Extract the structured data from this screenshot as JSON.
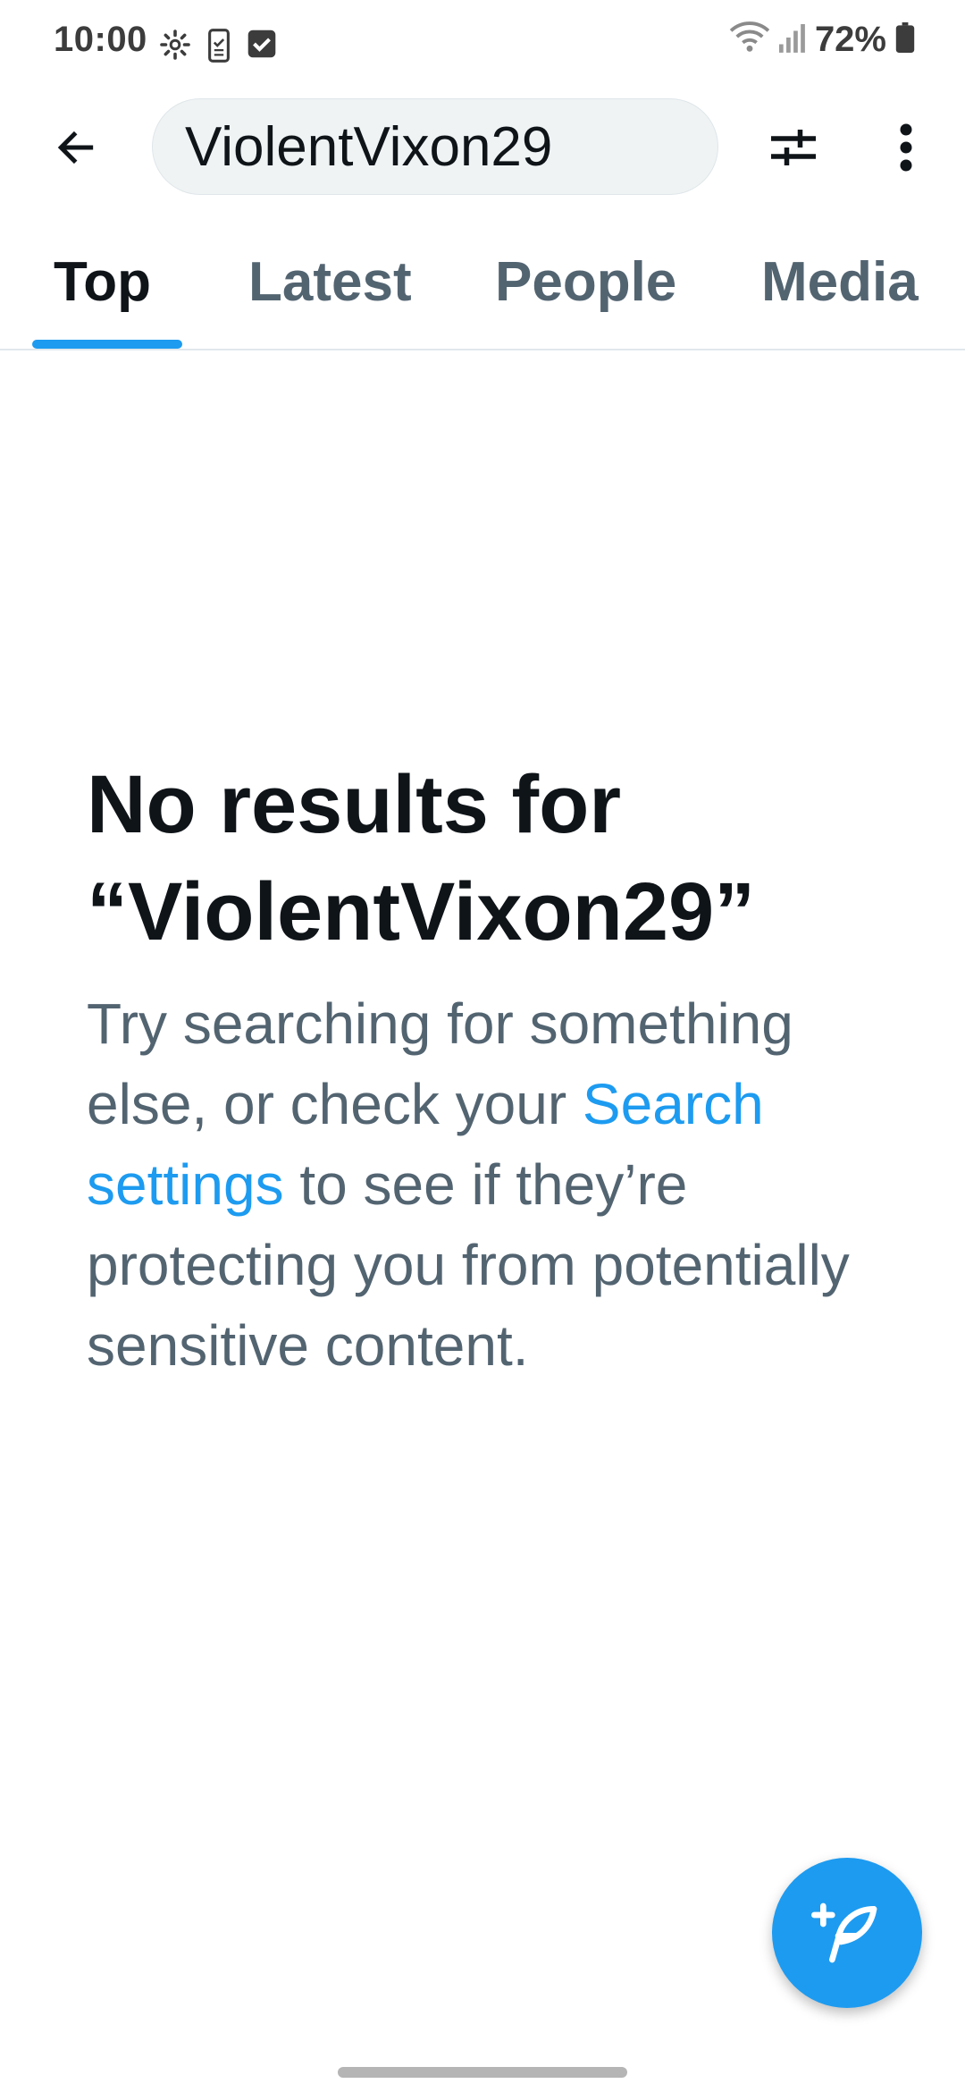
{
  "status_bar": {
    "time": "10:00",
    "battery": "72%",
    "icons_left": [
      "settings-icon",
      "phone-clipboard-icon",
      "checkbox-icon"
    ],
    "icons_right": [
      "wifi-icon",
      "signal-icon",
      "battery-icon"
    ]
  },
  "app_bar": {
    "back_icon": "arrow-left-icon",
    "search_query": "ViolentVixon29",
    "filter_icon": "sliders-icon",
    "overflow_icon": "more-vertical-icon"
  },
  "tabs": [
    {
      "label": "Top",
      "active": true
    },
    {
      "label": "Latest",
      "active": false
    },
    {
      "label": "People",
      "active": false
    },
    {
      "label": "Media",
      "active": false
    }
  ],
  "empty_state": {
    "title_line1": "No results for",
    "title_line2": "“ViolentVixon29”",
    "body_part1": "Try searching for something else, or check your ",
    "link_text": "Search settings",
    "body_part2": " to see if they’re protecting you from potentially sensitive content."
  },
  "fab": {
    "icon": "compose-feather-icon"
  },
  "colors": {
    "accent": "#1d9bf0",
    "primary_text": "#0f1419",
    "secondary_text": "#536471",
    "search_bg": "#eff3f4"
  }
}
